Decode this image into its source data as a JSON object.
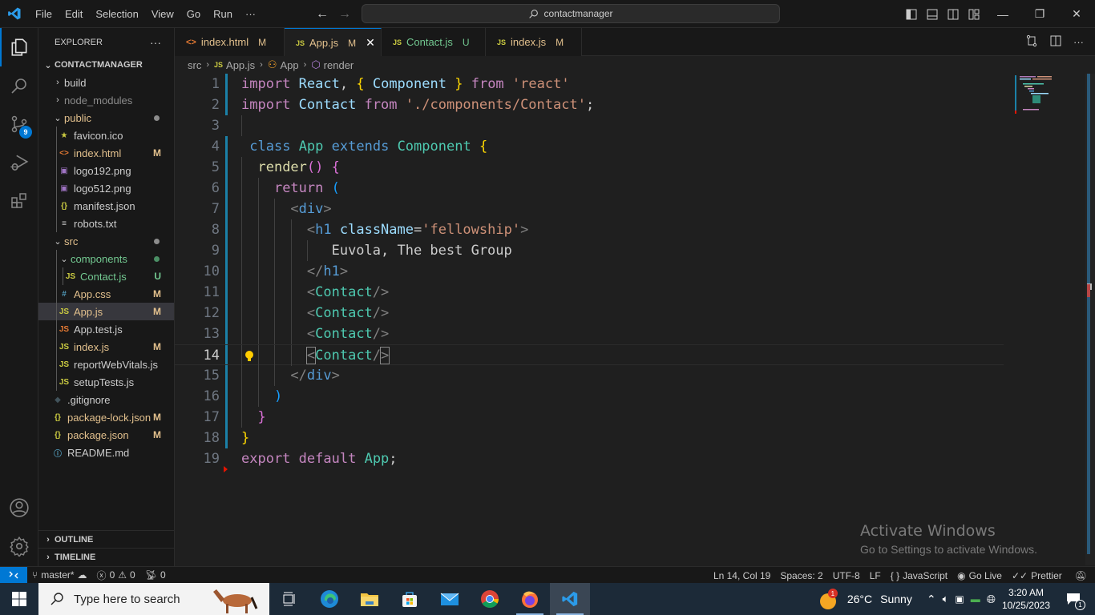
{
  "titlebar": {
    "menu": [
      "File",
      "Edit",
      "Selection",
      "View",
      "Go",
      "Run",
      "···"
    ],
    "command_center": "contactmanager",
    "window_controls": {
      "minimize": "—",
      "restore": "❐",
      "close": "✕"
    }
  },
  "activitybar": {
    "items": [
      "explorer-icon",
      "search-icon",
      "source-control-icon",
      "run-debug-icon",
      "extensions-icon"
    ],
    "source_control_badge": "9",
    "bottom": [
      "accounts-icon",
      "manage-gear-icon"
    ]
  },
  "sidebar": {
    "title": "EXPLORER",
    "more": "···",
    "project": "CONTACTMANAGER",
    "tree": [
      {
        "name": "build",
        "type": "folder",
        "open": false,
        "depth": 0,
        "color": "#cccccc"
      },
      {
        "name": "node_modules",
        "type": "folder",
        "open": false,
        "depth": 0,
        "color": "#8c8c8c"
      },
      {
        "name": "public",
        "type": "folder",
        "open": true,
        "depth": 0,
        "color": "#e2c08d",
        "dot": "#8c8c8c"
      },
      {
        "name": "favicon.ico",
        "type": "file",
        "icon": "★",
        "icon_color": "#cbcb41",
        "depth": 1,
        "color": "#cccccc"
      },
      {
        "name": "index.html",
        "type": "file",
        "icon": "<>",
        "icon_color": "#e37933",
        "depth": 1,
        "color": "#e2c08d",
        "status": "M"
      },
      {
        "name": "logo192.png",
        "type": "file",
        "icon": "▣",
        "icon_color": "#a074c4",
        "depth": 1,
        "color": "#cccccc"
      },
      {
        "name": "logo512.png",
        "type": "file",
        "icon": "▣",
        "icon_color": "#a074c4",
        "depth": 1,
        "color": "#cccccc"
      },
      {
        "name": "manifest.json",
        "type": "file",
        "icon": "{}",
        "icon_color": "#cbcb41",
        "depth": 1,
        "color": "#cccccc"
      },
      {
        "name": "robots.txt",
        "type": "file",
        "icon": "≡",
        "icon_color": "#cccccc",
        "depth": 1,
        "color": "#cccccc"
      },
      {
        "name": "src",
        "type": "folder",
        "open": true,
        "depth": 0,
        "color": "#e2c08d",
        "dot": "#8c8c8c"
      },
      {
        "name": "components",
        "type": "folder",
        "open": true,
        "depth": 1,
        "color": "#73c991",
        "dot": "#4b8f65"
      },
      {
        "name": "Contact.js",
        "type": "file",
        "icon": "JS",
        "icon_color": "#cbcb41",
        "depth": 2,
        "color": "#73c991",
        "status": "U",
        "status_color": "#73c991"
      },
      {
        "name": "App.css",
        "type": "file",
        "icon": "#",
        "icon_color": "#519aba",
        "depth": 1,
        "color": "#e2c08d",
        "status": "M"
      },
      {
        "name": "App.js",
        "type": "file",
        "icon": "JS",
        "icon_color": "#cbcb41",
        "depth": 1,
        "color": "#e2c08d",
        "status": "M",
        "selected": true
      },
      {
        "name": "App.test.js",
        "type": "file",
        "icon": "JS",
        "icon_color": "#e37933",
        "depth": 1,
        "color": "#cccccc"
      },
      {
        "name": "index.js",
        "type": "file",
        "icon": "JS",
        "icon_color": "#cbcb41",
        "depth": 1,
        "color": "#e2c08d",
        "status": "M"
      },
      {
        "name": "reportWebVitals.js",
        "type": "file",
        "icon": "JS",
        "icon_color": "#cbcb41",
        "depth": 1,
        "color": "#cccccc"
      },
      {
        "name": "setupTests.js",
        "type": "file",
        "icon": "JS",
        "icon_color": "#cbcb41",
        "depth": 1,
        "color": "#cccccc"
      },
      {
        "name": ".gitignore",
        "type": "file",
        "icon": "◆",
        "icon_color": "#41535b",
        "depth": 0,
        "color": "#cccccc"
      },
      {
        "name": "package-lock.json",
        "type": "file",
        "icon": "{}",
        "icon_color": "#cbcb41",
        "depth": 0,
        "color": "#e2c08d",
        "status": "M"
      },
      {
        "name": "package.json",
        "type": "file",
        "icon": "{}",
        "icon_color": "#cbcb41",
        "depth": 0,
        "color": "#e2c08d",
        "status": "M"
      },
      {
        "name": "README.md",
        "type": "file",
        "icon": "ⓘ",
        "icon_color": "#519aba",
        "depth": 0,
        "color": "#cccccc"
      }
    ],
    "outline": "OUTLINE",
    "timeline": "TIMELINE"
  },
  "tabs": [
    {
      "label": "index.html",
      "icon": "<>",
      "icon_color": "#e37933",
      "label_color": "#e2c08d",
      "mark": "M",
      "active": false
    },
    {
      "label": "App.js",
      "icon": "JS",
      "icon_color": "#cbcb41",
      "label_color": "#e2c08d",
      "mark": "M",
      "active": true,
      "close": "✕"
    },
    {
      "label": "Contact.js",
      "icon": "JS",
      "icon_color": "#cbcb41",
      "label_color": "#73c991",
      "mark": "U",
      "active": false
    },
    {
      "label": "index.js",
      "icon": "JS",
      "icon_color": "#cbcb41",
      "label_color": "#e2c08d",
      "mark": "M",
      "active": false
    }
  ],
  "breadcrumb": {
    "folder": "src",
    "file": "App.js",
    "class": "App",
    "method": "render"
  },
  "editor": {
    "current_line": 14,
    "lines": [
      {
        "n": "1",
        "tokens": [
          [
            "kw",
            "import"
          ],
          [
            "txt",
            " "
          ],
          [
            "var",
            "React"
          ],
          [
            "punct",
            ", "
          ],
          [
            "b1",
            "{"
          ],
          [
            "txt",
            " "
          ],
          [
            "var",
            "Component"
          ],
          [
            "txt",
            " "
          ],
          [
            "b1",
            "}"
          ],
          [
            "txt",
            " "
          ],
          [
            "kw",
            "from"
          ],
          [
            "txt",
            " "
          ],
          [
            "str",
            "'react'"
          ]
        ]
      },
      {
        "n": "2",
        "tokens": [
          [
            "kw",
            "import"
          ],
          [
            "txt",
            " "
          ],
          [
            "var",
            "Contact"
          ],
          [
            "txt",
            " "
          ],
          [
            "kw",
            "from"
          ],
          [
            "txt",
            " "
          ],
          [
            "str",
            "'./components/Contact'"
          ],
          [
            "punct",
            ";"
          ]
        ]
      },
      {
        "n": "3",
        "tokens": []
      },
      {
        "n": "4",
        "tokens": [
          [
            "txt",
            " "
          ],
          [
            "kw2",
            "class"
          ],
          [
            "txt",
            " "
          ],
          [
            "cls",
            "App"
          ],
          [
            "txt",
            " "
          ],
          [
            "kw2",
            "extends"
          ],
          [
            "txt",
            " "
          ],
          [
            "cls",
            "Component"
          ],
          [
            "txt",
            " "
          ],
          [
            "b1",
            "{"
          ]
        ]
      },
      {
        "n": "5",
        "tokens": [
          [
            "txt",
            "  "
          ],
          [
            "fn",
            "render"
          ],
          [
            "b2",
            "()"
          ],
          [
            "txt",
            " "
          ],
          [
            "b2",
            "{"
          ]
        ]
      },
      {
        "n": "6",
        "tokens": [
          [
            "txt",
            "    "
          ],
          [
            "kw",
            "return"
          ],
          [
            "txt",
            " "
          ],
          [
            "b3",
            "("
          ]
        ]
      },
      {
        "n": "7",
        "tokens": [
          [
            "txt",
            "      "
          ],
          [
            "tag",
            "<"
          ],
          [
            "tagn",
            "div"
          ],
          [
            "tag",
            ">"
          ]
        ]
      },
      {
        "n": "8",
        "tokens": [
          [
            "txt",
            "        "
          ],
          [
            "tag",
            "<"
          ],
          [
            "tagn",
            "h1"
          ],
          [
            "txt",
            " "
          ],
          [
            "attr",
            "className"
          ],
          [
            "punct",
            "="
          ],
          [
            "str",
            "'fellowship'"
          ],
          [
            "tag",
            ">"
          ]
        ]
      },
      {
        "n": "9",
        "tokens": [
          [
            "txt",
            "           "
          ],
          [
            "txt",
            "Euvola, The best Group"
          ]
        ]
      },
      {
        "n": "10",
        "tokens": [
          [
            "txt",
            "        "
          ],
          [
            "tag",
            "</"
          ],
          [
            "tagn",
            "h1"
          ],
          [
            "tag",
            ">"
          ]
        ]
      },
      {
        "n": "11",
        "tokens": [
          [
            "txt",
            "        "
          ],
          [
            "tag",
            "<"
          ],
          [
            "cls",
            "Contact"
          ],
          [
            "tag",
            "/>"
          ]
        ]
      },
      {
        "n": "12",
        "tokens": [
          [
            "txt",
            "        "
          ],
          [
            "tag",
            "<"
          ],
          [
            "cls",
            "Contact"
          ],
          [
            "tag",
            "/>"
          ]
        ]
      },
      {
        "n": "13",
        "tokens": [
          [
            "txt",
            "        "
          ],
          [
            "tag",
            "<"
          ],
          [
            "cls",
            "Contact"
          ],
          [
            "tag",
            "/>"
          ]
        ]
      },
      {
        "n": "14",
        "tokens": [
          [
            "txt",
            "        "
          ],
          [
            "tag",
            "<"
          ],
          [
            "cls",
            "Contact"
          ],
          [
            "tag",
            "/"
          ],
          [
            "tag",
            ">"
          ]
        ]
      },
      {
        "n": "15",
        "tokens": [
          [
            "txt",
            "      "
          ],
          [
            "tag",
            "</"
          ],
          [
            "tagn",
            "div"
          ],
          [
            "tag",
            ">"
          ]
        ]
      },
      {
        "n": "16",
        "tokens": [
          [
            "txt",
            "    "
          ],
          [
            "b3",
            ")"
          ]
        ]
      },
      {
        "n": "17",
        "tokens": [
          [
            "txt",
            "  "
          ],
          [
            "b2",
            "}"
          ]
        ]
      },
      {
        "n": "18",
        "tokens": [
          [
            "b1",
            "}"
          ]
        ]
      },
      {
        "n": "19",
        "tokens": [
          [
            "kw",
            "export"
          ],
          [
            "txt",
            " "
          ],
          [
            "kw",
            "default"
          ],
          [
            "txt",
            " "
          ],
          [
            "cls",
            "App"
          ],
          [
            "punct",
            ";"
          ]
        ]
      }
    ]
  },
  "watermark": {
    "title": "Activate Windows",
    "subtitle": "Go to Settings to activate Windows."
  },
  "statusbar": {
    "branch": "master*",
    "errors": "0",
    "warnings": "0",
    "ports": "0",
    "position": "Ln 14, Col 19",
    "spaces": "Spaces: 2",
    "encoding": "UTF-8",
    "eol": "LF",
    "language": "JavaScript",
    "golive": "Go Live",
    "prettier": "Prettier"
  },
  "taskbar": {
    "search_placeholder": "Type here to search",
    "apps": [
      "task-view-icon",
      "edge-icon",
      "file-explorer-icon",
      "microsoft-store-icon",
      "mail-icon",
      "chrome-icon",
      "firefox-icon",
      "vscode-icon"
    ],
    "weather_temp": "26°C",
    "weather_desc": "Sunny",
    "weather_badge": "1",
    "time": "3:20 AM",
    "date": "10/25/2023",
    "notifications": "1"
  }
}
